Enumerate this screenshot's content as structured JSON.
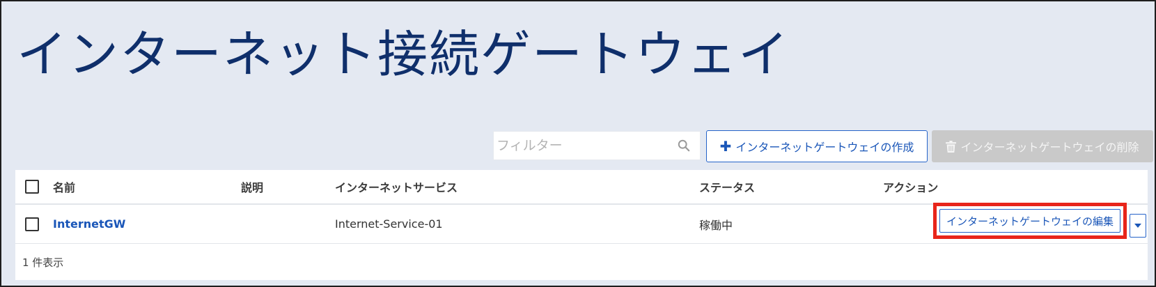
{
  "page": {
    "title": "インターネット接続ゲートウェイ"
  },
  "toolbar": {
    "filter_placeholder": "フィルター",
    "create_label": "インターネットゲートウェイの作成",
    "delete_label": "インターネットゲートウェイの削除"
  },
  "table": {
    "columns": [
      "名前",
      "説明",
      "インターネットサービス",
      "ステータス",
      "アクション"
    ],
    "rows": [
      {
        "name": "InternetGW",
        "description": "",
        "internet_service": "Internet-Service-01",
        "status": "稼働中",
        "action_label": "インターネットゲートウェイの編集"
      }
    ],
    "footer": "1 件表示"
  },
  "icons": {
    "search": "search-icon",
    "plus": "plus-icon",
    "trash": "trash-icon",
    "dropdown": "chevron-down-icon"
  },
  "colors": {
    "accent": "#1a56b8",
    "title": "#0f2f6b",
    "background": "#e4e9f2",
    "highlight": "#e8251a",
    "disabled": "#c9c9c9"
  }
}
